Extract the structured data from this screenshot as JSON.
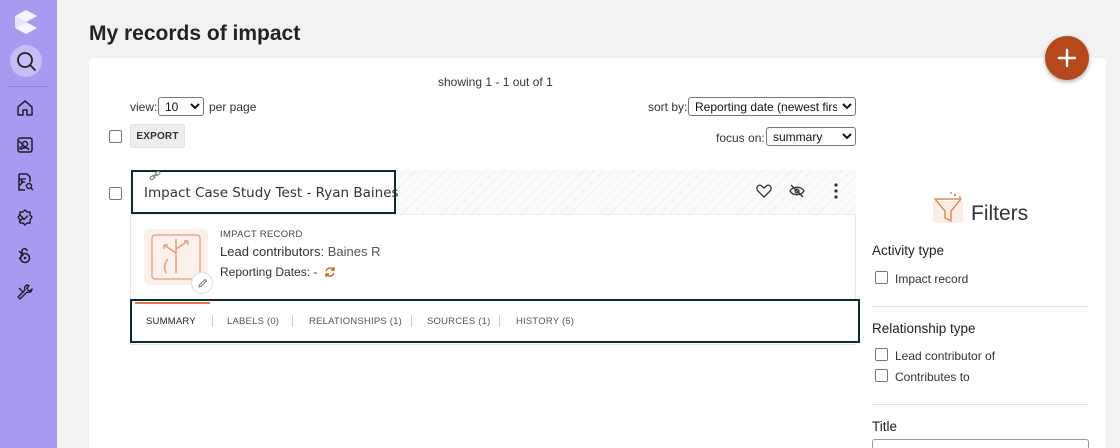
{
  "page": {
    "title": "My records of impact",
    "add_button_icon": "plus-icon"
  },
  "sidebar": {
    "items": [
      {
        "icon": "home-icon"
      },
      {
        "icon": "profile-search-icon"
      },
      {
        "icon": "document-search-icon"
      },
      {
        "icon": "badge-check-icon"
      },
      {
        "icon": "open-access-icon"
      },
      {
        "icon": "wrench-icon"
      }
    ]
  },
  "list": {
    "showing": "showing 1 - 1 out of 1",
    "view_label": "view:",
    "view_value": "10",
    "per_page_label": "per page",
    "sort_label": "sort by:",
    "sort_value": "Reporting date (newest first)",
    "focus_label": "focus on:",
    "focus_value": "summary",
    "export_label": "EXPORT"
  },
  "record": {
    "title": "Impact Case Study Test - Ryan Baines",
    "type": "IMPACT RECORD",
    "lead_label": "Lead contributors:",
    "lead_value": "Baines R",
    "dates_label": "Reporting Dates: -",
    "tabs": [
      {
        "label": "SUMMARY"
      },
      {
        "label": "LABELS (0)"
      },
      {
        "label": "RELATIONSHIPS (1)"
      },
      {
        "label": "SOURCES (1)"
      },
      {
        "label": "HISTORY (5)"
      }
    ]
  },
  "filters": {
    "title": "Filters",
    "activity_type": {
      "heading": "Activity type",
      "options": [
        "Impact record"
      ]
    },
    "relationship_type": {
      "heading": "Relationship type",
      "options": [
        "Lead contributor of",
        "Contributes to"
      ]
    },
    "title_filter": {
      "heading": "Title"
    }
  },
  "colors": {
    "sidebar": "#a79af0",
    "accent": "#b5481c",
    "tab_accent": "#e07a4a",
    "highlight_border": "#0f2a33"
  }
}
